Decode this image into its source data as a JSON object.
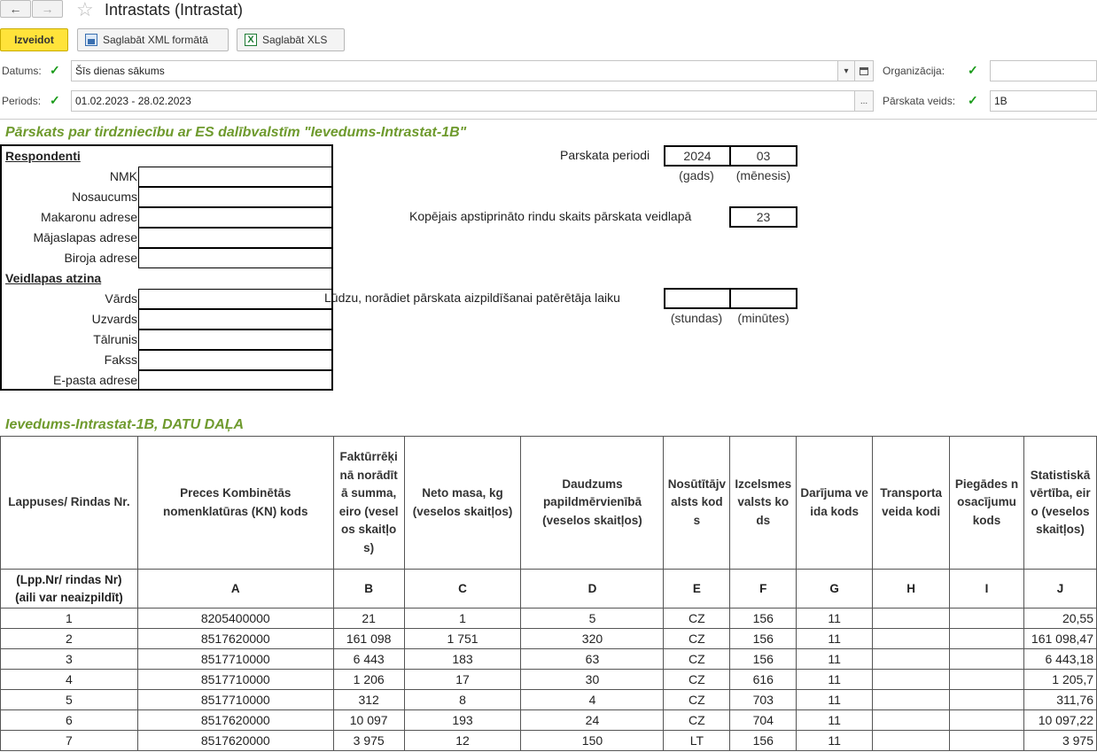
{
  "window": {
    "title": "Intrastats (Intrastat)"
  },
  "toolbar": {
    "create_label": "Izveidot",
    "save_xml_label": "Saglabāt XML formātā",
    "save_xls_label": "Saglabāt XLS"
  },
  "filters": {
    "date_label": "Datums:",
    "date_value": "Šīs dienas sākums",
    "period_label": "Periods:",
    "period_value": "01.02.2023 - 28.02.2023",
    "org_label": "Organizācija:",
    "org_value": "",
    "report_type_label": "Pārskata veids:",
    "report_type_value": "1B",
    "ellipsis": "..."
  },
  "report": {
    "heading": "Pārskats par tirdzniecību ar ES dalībvalstīm \"Ievedums-Intrastat-1B\"",
    "respondents_title": "Respondenti",
    "respondent_fields": [
      "NMK",
      "Nosaucums",
      "Makaronu adrese",
      "Mājaslapas adrese",
      "Biroja adrese"
    ],
    "filler_title": "Veidlapas atzina",
    "filler_fields": [
      "Vārds",
      "Uzvards",
      "Tālrunis",
      "Fakss",
      "E-pasta adrese"
    ],
    "period_label": "Parskata periodi",
    "period_year": "2024",
    "period_month": "03",
    "year_caption": "(gads)",
    "month_caption": "(mēnesis)",
    "rows_label": "Kopējais apstiprināto rindu skaits pārskata veidlapā",
    "rows_value": "23",
    "time_label": "Lūdzu, norādiet pārskata aizpildīšanai patērētāja laiku",
    "hours_caption": "(stundas)",
    "minutes_caption": "(minūtes)",
    "data_heading": "Ievedums-Intrastat-1B, DATU DAĻA"
  },
  "table": {
    "headers": [
      "Lappuses/ Rindas Nr.",
      "Preces Kombinētās nomenklatūras (KN) kods",
      "Faktūrrēķinā norādītā summa, eiro (veselos skaitļos)",
      "Neto masa, kg (veselos skaitļos)",
      "Daudzums papildmērvienībā (veselos skaitļos)",
      "Nosūtītājvalsts kods",
      "Izcelsmes valsts kods",
      "Darījuma veida kods",
      "Transporta veida kodi",
      "Piegādes nosacījumu kods",
      "Statistiskā vērtība, eiro (veselos skaitļos)"
    ],
    "letters": [
      "(Lpp.Nr/ rindas Nr) (aili var neaizpildīt)",
      "A",
      "B",
      "C",
      "D",
      "E",
      "F",
      "G",
      "H",
      "I",
      "J"
    ],
    "rows": [
      [
        "1",
        "8205400000",
        "21",
        "1",
        "5",
        "CZ",
        "156",
        "11",
        "",
        "",
        "20,55"
      ],
      [
        "2",
        "8517620000",
        "161 098",
        "1 751",
        "320",
        "CZ",
        "156",
        "11",
        "",
        "",
        "161 098,47"
      ],
      [
        "3",
        "8517710000",
        "6 443",
        "183",
        "63",
        "CZ",
        "156",
        "11",
        "",
        "",
        "6 443,18"
      ],
      [
        "4",
        "8517710000",
        "1 206",
        "17",
        "30",
        "CZ",
        "616",
        "11",
        "",
        "",
        "1 205,7"
      ],
      [
        "5",
        "8517710000",
        "312",
        "8",
        "4",
        "CZ",
        "703",
        "11",
        "",
        "",
        "311,76"
      ],
      [
        "6",
        "8517620000",
        "10 097",
        "193",
        "24",
        "CZ",
        "704",
        "11",
        "",
        "",
        "10 097,22"
      ],
      [
        "7",
        "8517620000",
        "3 975",
        "12",
        "150",
        "LT",
        "156",
        "11",
        "",
        "",
        "3 975"
      ]
    ]
  }
}
